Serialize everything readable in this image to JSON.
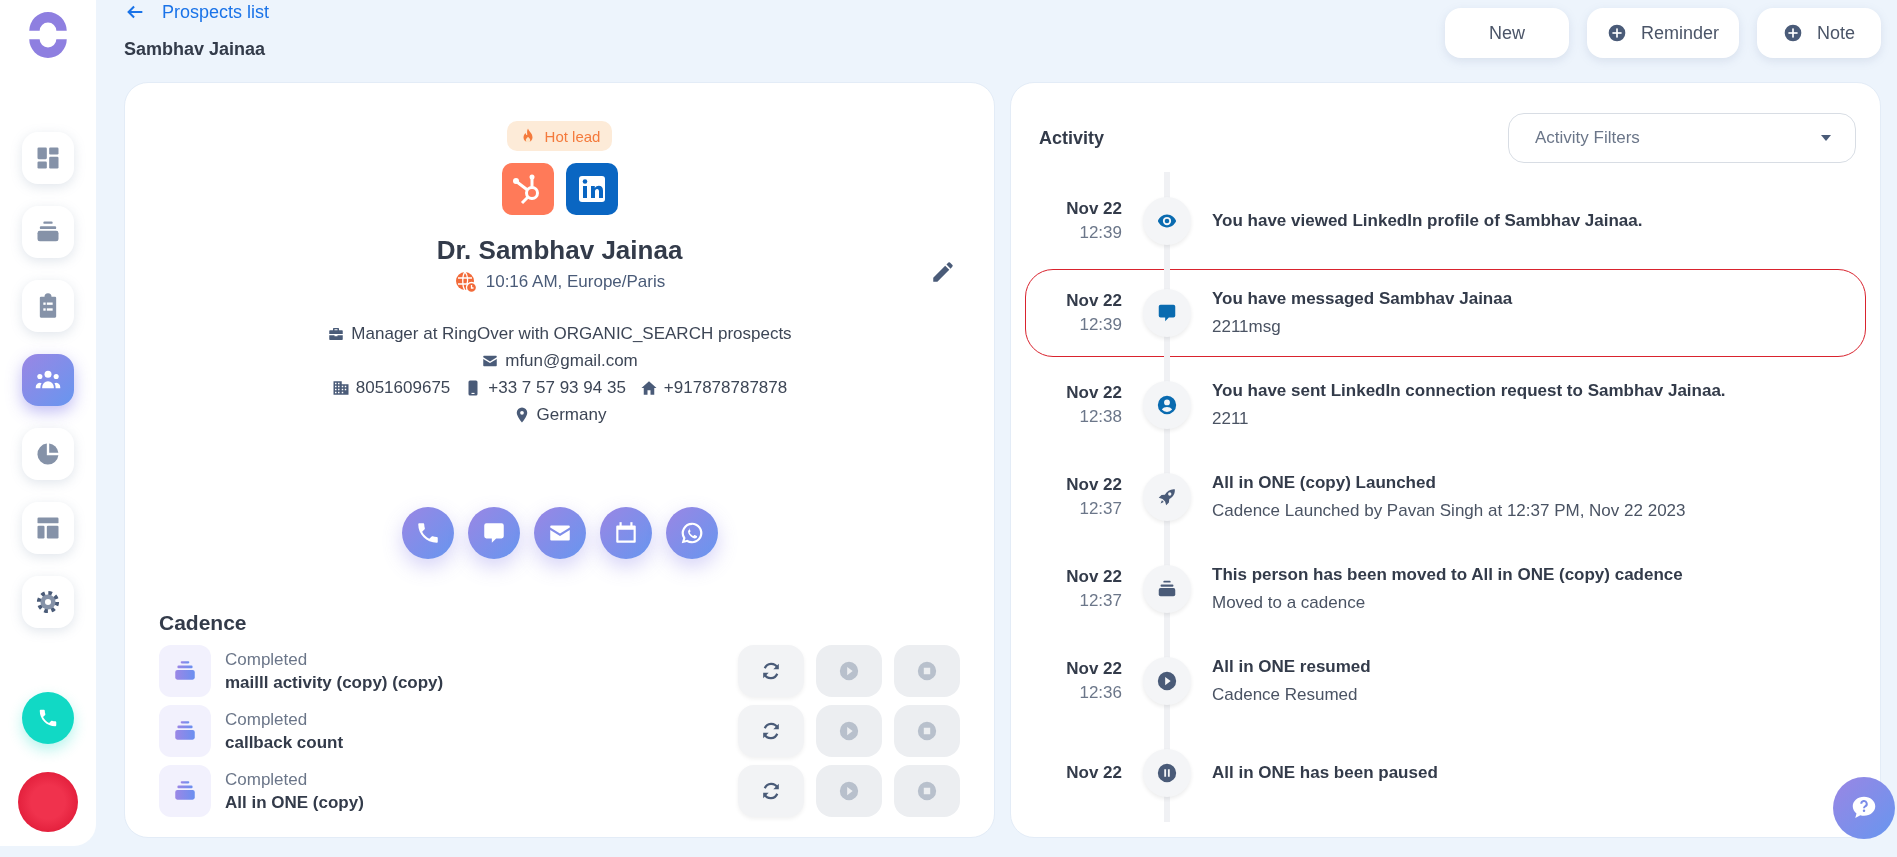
{
  "sidebar": {
    "items": [
      {
        "kind": "dashboard",
        "selected": false
      },
      {
        "kind": "cadence",
        "selected": false
      },
      {
        "kind": "tasks",
        "selected": false
      },
      {
        "kind": "people",
        "selected": true
      },
      {
        "kind": "reports",
        "selected": false
      },
      {
        "kind": "templates",
        "selected": false
      },
      {
        "kind": "settings",
        "selected": false
      }
    ]
  },
  "header": {
    "back_link": "Prospects list",
    "page_title": "Sambhav Jainaa"
  },
  "toolbar": [
    {
      "label": "New",
      "kind": "plain"
    },
    {
      "label": "Reminder",
      "kind": "add"
    },
    {
      "label": "Note",
      "kind": "add"
    }
  ],
  "profile": {
    "badge": "Hot lead",
    "integrations": [
      {
        "kind": "hubspot"
      },
      {
        "kind": "linkedin"
      }
    ],
    "name": "Dr. Sambhav Jainaa",
    "local_time": "10:16 AM, Europe/Paris",
    "details": [
      [
        {
          "kind": "briefcase",
          "text": "Manager at RingOver with ORGANIC_SEARCH prospects"
        }
      ],
      [
        {
          "kind": "mail",
          "text": "mfun@gmail.com"
        }
      ],
      [
        {
          "kind": "building",
          "text": "8051609675"
        },
        {
          "kind": "mobile",
          "text": "+33 7 57 93 94 35"
        },
        {
          "kind": "home",
          "text": "+917878787878"
        }
      ],
      [
        {
          "kind": "pin",
          "text": "Germany"
        }
      ]
    ],
    "actions": [
      {
        "kind": "phone"
      },
      {
        "kind": "message"
      },
      {
        "kind": "mail"
      },
      {
        "kind": "calendar"
      },
      {
        "kind": "whatsapp"
      }
    ]
  },
  "cadence": {
    "title": "Cadence",
    "rows": [
      {
        "status": "Completed",
        "name": "mailll activity (copy) (copy)",
        "controls": [
          {
            "kind": "refresh",
            "disabled": false
          },
          {
            "kind": "play",
            "disabled": true
          },
          {
            "kind": "stop",
            "disabled": true
          }
        ]
      },
      {
        "status": "Completed",
        "name": "callback count",
        "controls": [
          {
            "kind": "refresh",
            "disabled": false
          },
          {
            "kind": "play",
            "disabled": true
          },
          {
            "kind": "stop",
            "disabled": true
          }
        ]
      },
      {
        "status": "Completed",
        "name": "All in ONE (copy)",
        "controls": [
          {
            "kind": "refresh",
            "disabled": false
          },
          {
            "kind": "play",
            "disabled": true
          },
          {
            "kind": "stop",
            "disabled": true
          }
        ]
      }
    ]
  },
  "activity": {
    "title": "Activity",
    "filter": {
      "placeholder": "Activity Filters"
    },
    "items": [
      {
        "date": "Nov 22",
        "time": "12:39",
        "kind": "eye",
        "title": "You have viewed LinkedIn profile of Sambhav Jainaa.",
        "highlighted": false
      },
      {
        "date": "Nov 22",
        "time": "12:39",
        "kind": "message",
        "title": "You have messaged Sambhav Jainaa",
        "subtitle": "2211msg",
        "highlighted": true
      },
      {
        "date": "Nov 22",
        "time": "12:38",
        "kind": "person",
        "title": "You have sent LinkedIn connection request to Sambhav Jainaa.",
        "subtitle": "2211",
        "highlighted": false
      },
      {
        "date": "Nov 22",
        "time": "12:37",
        "kind": "rocket",
        "title": "All in ONE (copy) Launched",
        "subtitle": "Cadence Launched by Pavan Singh at 12:37 PM, Nov 22 2023",
        "highlighted": false
      },
      {
        "date": "Nov 22",
        "time": "12:37",
        "kind": "cadence",
        "title": "This person has been moved to All in ONE (copy) cadence",
        "subtitle": "Moved to a cadence",
        "highlighted": false
      },
      {
        "date": "Nov 22",
        "time": "12:36",
        "kind": "play",
        "title": "All in ONE resumed",
        "subtitle": "Cadence Resumed",
        "highlighted": false
      },
      {
        "date": "Nov 22",
        "kind": "pause",
        "title": "All in ONE has been paused",
        "highlighted": false
      }
    ]
  }
}
